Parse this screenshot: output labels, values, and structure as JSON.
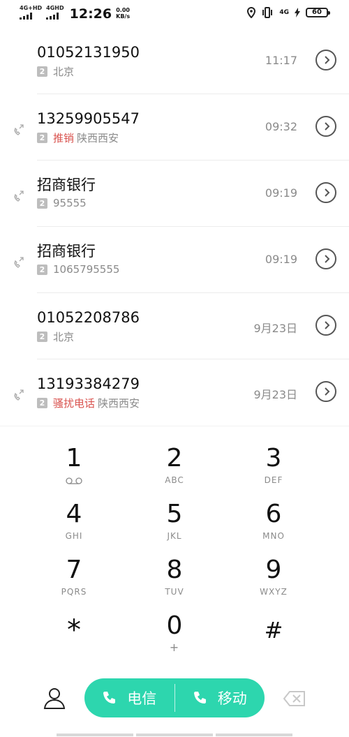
{
  "status_bar": {
    "signal1": "4G+HD",
    "signal2": "4GHD",
    "time": "12:26",
    "speed_value": "0.00",
    "speed_unit": "KB/s",
    "net": "4G",
    "battery": "60",
    "icons": [
      "location-icon",
      "vibrate-icon",
      "charging-icon"
    ]
  },
  "calls": [
    {
      "number": "01052131950",
      "sim": "2",
      "tag": "",
      "location": "北京",
      "time": "11:17",
      "type_icon": ""
    },
    {
      "number": "13259905547",
      "sim": "2",
      "tag": "推销",
      "location": "陕西西安",
      "time": "09:32",
      "type_icon": "missed-call-icon"
    },
    {
      "number": "招商银行",
      "sim": "2",
      "tag": "",
      "location": "95555",
      "time": "09:19",
      "type_icon": "missed-call-icon"
    },
    {
      "number": "招商银行",
      "sim": "2",
      "tag": "",
      "location": "1065795555",
      "time": "09:19",
      "type_icon": "missed-call-icon"
    },
    {
      "number": "01052208786",
      "sim": "2",
      "tag": "",
      "location": "北京",
      "time": "9月23日",
      "type_icon": ""
    },
    {
      "number": "13193384279",
      "sim": "2",
      "tag": "骚扰电话",
      "location": "陕西西安",
      "time": "9月23日",
      "type_icon": "missed-call-icon"
    }
  ],
  "keypad": [
    {
      "digit": "1",
      "letters": ""
    },
    {
      "digit": "2",
      "letters": "ABC"
    },
    {
      "digit": "3",
      "letters": "DEF"
    },
    {
      "digit": "4",
      "letters": "GHI"
    },
    {
      "digit": "5",
      "letters": "JKL"
    },
    {
      "digit": "6",
      "letters": "MNO"
    },
    {
      "digit": "7",
      "letters": "PQRS"
    },
    {
      "digit": "8",
      "letters": "TUV"
    },
    {
      "digit": "9",
      "letters": "WXYZ"
    },
    {
      "digit": "*",
      "letters": ""
    },
    {
      "digit": "0",
      "letters": "+"
    },
    {
      "digit": "#",
      "letters": ""
    }
  ],
  "bottom": {
    "call_sim1_label": "电信",
    "call_sim2_label": "移动",
    "accent_color": "#2dd6ae"
  }
}
